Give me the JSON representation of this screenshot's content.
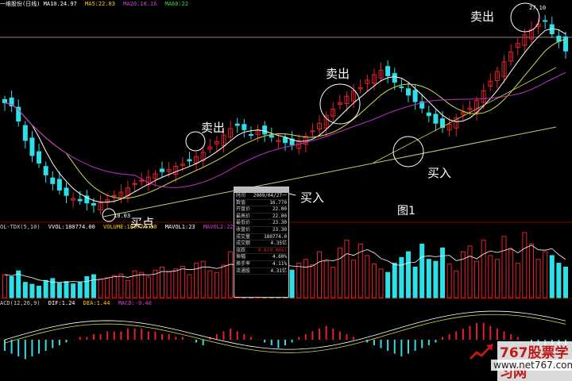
{
  "header": {
    "price_title": "一维股份(日线) MA10.24.97",
    "ma1": "MA5:22.03",
    "ma2": "MA20.18.16",
    "ma3": "MA60:22"
  },
  "vol_header": {
    "title": "OL-TDX(5,10)",
    "vvol": "VVOL:180774.00",
    "volume": "VOLUME:180774.00",
    "mavol1": "MAVOL1:23",
    "mavol2": "MAVOL2:220080.09"
  },
  "macd_header": {
    "title": "ACD(12,26,9)",
    "dif": "DIF:1.24",
    "dea": "DEA:1.44",
    "macd": "MACD:-0.40"
  },
  "annotations": {
    "sell_labels": [
      "卖出",
      "卖出",
      "卖出"
    ],
    "buy_labels": [
      "买入",
      "买入"
    ],
    "buy_point": "买点",
    "figure_label": "图1",
    "low_price": "10.03",
    "high_price": "27.10"
  },
  "infobox": {
    "rows": [
      {
        "k": "时间",
        "v": "2009/04/27一"
      },
      {
        "k": "数值",
        "v": "16.770"
      },
      {
        "k": "开盘价",
        "v": "22.00"
      },
      {
        "k": "最高价",
        "v": "22.00"
      },
      {
        "k": "最低价",
        "v": "23.30"
      },
      {
        "k": "收盘价",
        "v": "23.30"
      },
      {
        "k": "成交量",
        "v": "180774.0"
      },
      {
        "k": "成交额",
        "v": "4.35亿"
      },
      {
        "k": "涨跌",
        "v": "0.8(0.00%)"
      },
      {
        "k": "振幅",
        "v": "4.60%"
      },
      {
        "k": "换手率",
        "v": "4.11%"
      },
      {
        "k": "流通股",
        "v": "4.31亿"
      }
    ]
  },
  "watermark": {
    "site_cn": "767股票学习网",
    "url": "www.net767.com"
  },
  "colors": {
    "up": "#e8202a",
    "down": "#2de0e8",
    "ma_white": "#ffffff",
    "ma_yellow": "#d6d84a",
    "ma_magenta": "#c22fc8",
    "trend_line": "#c9c970"
  },
  "chart_data": [
    {
      "type": "bar",
      "name": "daily candlesticks (approximate)",
      "title": "",
      "series": [
        {
          "name": "close",
          "values": [
            19.5,
            19.2,
            17.8,
            16.0,
            14.6,
            13.9,
            12.8,
            12.0,
            11.4,
            10.9,
            10.6,
            10.4,
            10.2,
            10.0,
            10.2,
            10.5,
            10.9,
            11.2,
            11.6,
            12.0,
            12.3,
            12.6,
            12.9,
            13.1,
            13.3,
            13.6,
            13.8,
            14.1,
            14.5,
            14.9,
            15.4,
            15.9,
            16.5,
            17.1,
            17.4,
            17.0,
            16.5,
            16.9,
            16.6,
            16.3,
            16.0,
            15.8,
            15.6,
            15.9,
            16.4,
            16.9,
            17.6,
            18.3,
            18.9,
            19.5,
            20.1,
            20.6,
            20.9,
            21.6,
            22.1,
            22.5,
            22.0,
            21.4,
            20.9,
            20.2,
            19.6,
            19.0,
            18.3,
            17.6,
            17.2,
            17.5,
            18.1,
            18.6,
            19.0,
            19.7,
            20.6,
            21.5,
            22.4,
            23.3,
            24.2,
            25.0,
            25.8,
            26.3,
            26.8,
            27.1,
            25.9,
            25.2,
            24.3
          ]
        }
      ]
    },
    {
      "type": "bar",
      "name": "volume (approximate)",
      "series": [
        {
          "name": "volume",
          "values": [
            60,
            55,
            70,
            40,
            35,
            30,
            45,
            50,
            38,
            42,
            36,
            40,
            55,
            60,
            48,
            52,
            58,
            62,
            45,
            70,
            66,
            54,
            72,
            80,
            68,
            75,
            82,
            60,
            90,
            95,
            70,
            66,
            85,
            120,
            88,
            72,
            60,
            84,
            96,
            110,
            70,
            65,
            72,
            90,
            100,
            86,
            120,
            95,
            80,
            130,
            150,
            98,
            140,
            110,
            88,
            75,
            66,
            90,
            105,
            120,
            80,
            140,
            100,
            95,
            130,
            88,
            70,
            120,
            135,
            95,
            150,
            110,
            100,
            160,
            125,
            90,
            170,
            140,
            100,
            120,
            110,
            90,
            80
          ]
        }
      ]
    },
    {
      "type": "bar",
      "name": "MACD histogram (approximate)",
      "series": [
        {
          "name": "macd",
          "values": [
            -0.4,
            -0.5,
            -0.6,
            -0.7,
            -0.6,
            -0.5,
            -0.4,
            -0.3,
            -0.2,
            -0.1,
            0.0,
            0.1,
            0.1,
            0.2,
            0.2,
            0.3,
            0.3,
            0.3,
            0.4,
            0.4,
            0.4,
            0.3,
            0.3,
            0.2,
            0.2,
            0.1,
            0.1,
            0.0,
            -0.1,
            -0.2,
            0.1,
            0.2,
            0.3,
            0.4,
            0.3,
            0.2,
            0.1,
            0.0,
            -0.1,
            -0.2,
            -0.3,
            -0.2,
            -0.1,
            0.1,
            0.2,
            0.3,
            0.4,
            0.5,
            0.4,
            0.3,
            0.2,
            0.1,
            0.0,
            -0.1,
            -0.2,
            -0.3,
            -0.4,
            -0.5,
            -0.6,
            -0.5,
            -0.4,
            -0.3,
            -0.2,
            -0.1,
            0.1,
            0.2,
            0.3,
            0.4,
            0.5,
            0.6,
            0.6,
            0.5,
            0.4,
            0.3,
            0.2,
            0.1,
            0.0,
            -0.1,
            -0.2,
            -0.3,
            -0.35,
            -0.4,
            -0.4
          ]
        }
      ]
    }
  ]
}
